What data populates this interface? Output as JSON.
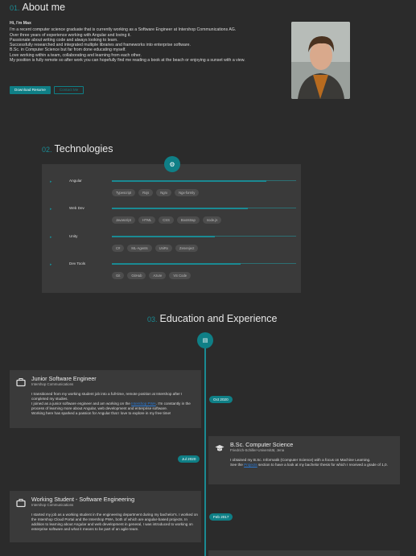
{
  "about": {
    "number": "01.",
    "title": "About me",
    "greeting": "Hi, I'm Max",
    "lines": [
      "I'm a recent computer science graduate that is currently working as a Software Engineer at Intershop Communications AG.",
      "Over three years of experience working with Angular and loving it.",
      "Passionate about writing code and always looking to learn.",
      "Successfully researched and integrated multiple libraries and frameworks into enterprise software.",
      "B.Sc. in Computer Science but far from done educating myself.",
      "Love working within a team, collaborating and learning from each other.",
      "My position is fully remote so after work you can hopefully find me reading a book at the beach or enjoying a sunset with a view."
    ],
    "download_label": "Download Resume",
    "contact_label": "Contact Me"
  },
  "technologies": {
    "number": "02.",
    "title": "Technologies",
    "groups": [
      {
        "name": "Angular",
        "level": 0.84,
        "chips": [
          "Typescript",
          "Rxjs",
          "Ngrx",
          "Ngx-formly"
        ]
      },
      {
        "name": "Web Dev",
        "level": 0.74,
        "chips": [
          "Javascript",
          "HTML",
          "CSS",
          "Bootstrap",
          "node.js"
        ]
      },
      {
        "name": "Unity",
        "level": 0.56,
        "chips": [
          "C#",
          "ML-Agents",
          "UniRx",
          "Zenenject"
        ]
      },
      {
        "name": "Dev Tools",
        "level": 0.7,
        "chips": [
          "Git",
          "GitHub",
          "Azure",
          "VS Code"
        ]
      }
    ]
  },
  "education": {
    "number": "03.",
    "title": "Education and Experience",
    "items": [
      {
        "title": "Junior Software Engineer",
        "org": "Intershop Communications",
        "date": "Oct 2020",
        "desc_1": "I transitioned from my working student job into a full-time, remote position at Intershop after I completed my studies.",
        "desc_2a": "I joined as a junior software engineer and am working on the ",
        "link": "Intershop PWA",
        "desc_2b": ". I'm constantly in the process of learning more about Angular, web development and enterprise software.",
        "desc_3": "Working here has sparked a passion for Angular that I love to explore in my free time!"
      },
      {
        "title": "B.Sc. Computer Science",
        "org": "Friedrich-Schiller-Universität, Jena",
        "date": "Jul 2020",
        "desc_1": "I obtained my B.Sc. Informatik (Computer Science) with a focus on Machine Learning.",
        "desc_2a": "See the ",
        "link": "Projects",
        "desc_2b": " section to have a look at my bachelor thesis for which I received a grade of 1,0."
      },
      {
        "title": "Working Student - Software Engineering",
        "org": "Intershop Communications",
        "date": "Feb 2017",
        "desc_1": "I started my job as a working student in the engineering department during my bachelor's. I worked on the Intershop Cloud Portal and the Intershop PWA, both of which are angular-based projects. In addition to learning about Angular and web development in general, I was introduced to working on enterprise software and what it means to be part of an agile team."
      }
    ]
  },
  "icons": {
    "tech": "gear-icon",
    "edu": "monitor-icon",
    "work": "briefcase-icon",
    "school": "graduation-cap-icon"
  },
  "colors": {
    "accent": "#0f7f86",
    "background": "#2b2b2b",
    "card": "#3a3a3a"
  }
}
